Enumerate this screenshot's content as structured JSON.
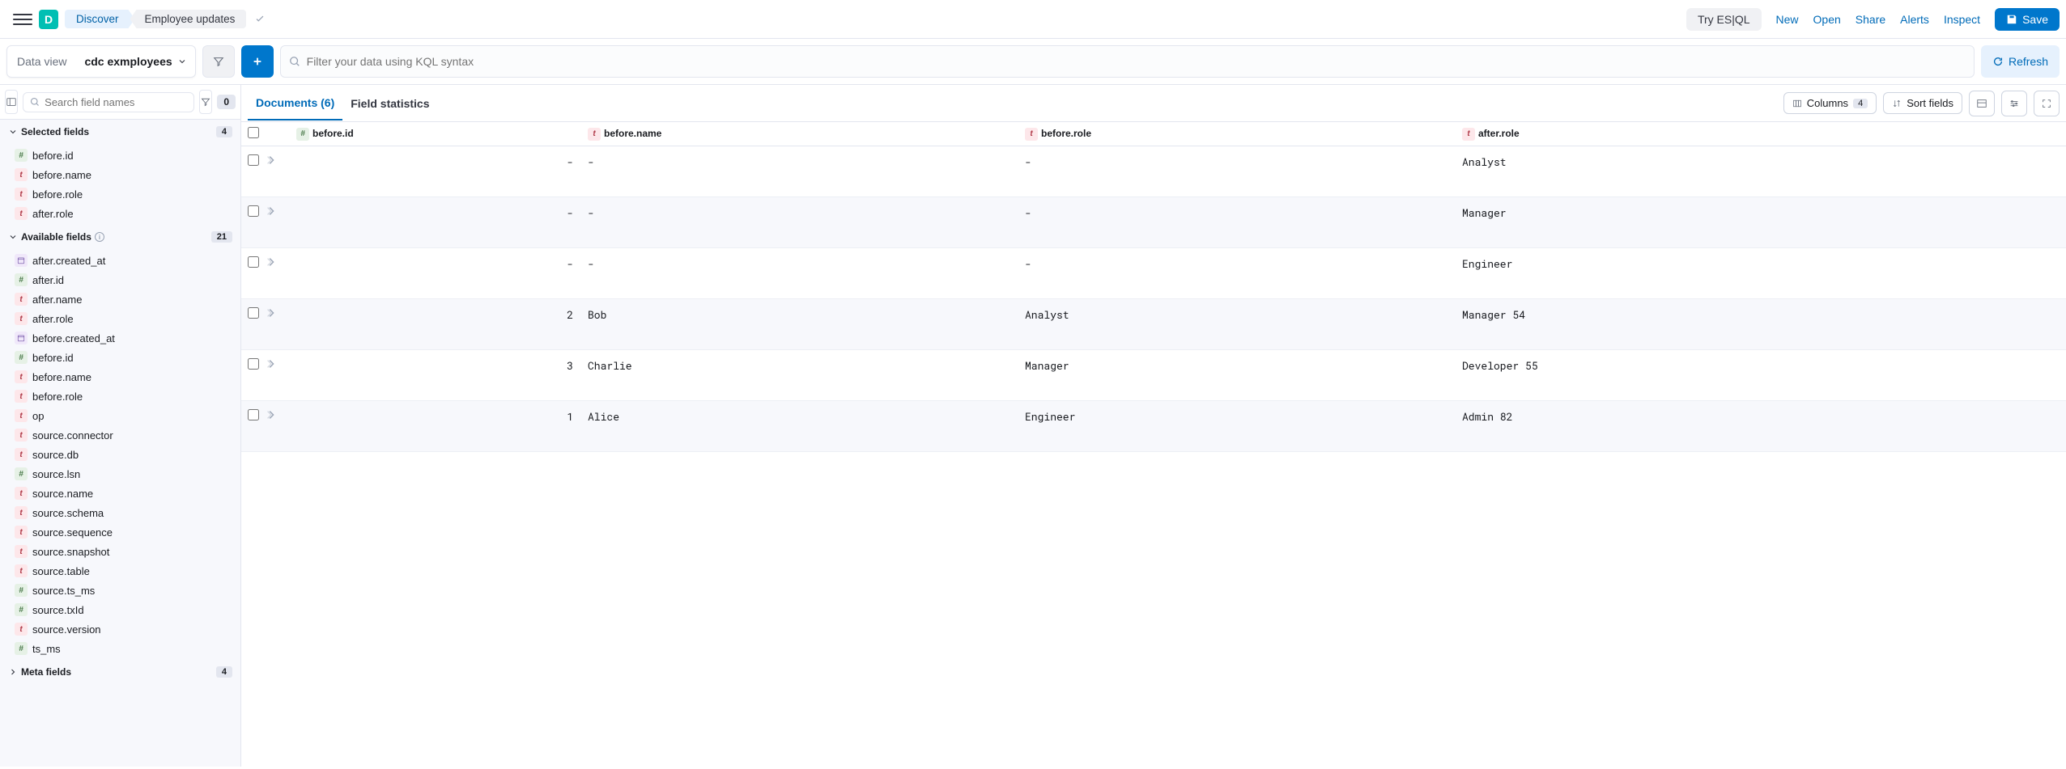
{
  "header": {
    "app_initial": "D",
    "breadcrumb1": "Discover",
    "breadcrumb2": "Employee updates",
    "try_esql": "Try ES|QL",
    "links": [
      "New",
      "Open",
      "Share",
      "Alerts",
      "Inspect"
    ],
    "save": "Save"
  },
  "querybar": {
    "dataview_label": "Data view",
    "dataview_value": "cdc exmployees",
    "search_placeholder": "Filter your data using KQL syntax",
    "refresh": "Refresh"
  },
  "sidebar": {
    "field_search_placeholder": "Search field names",
    "field_count": "0",
    "selected_title": "Selected fields",
    "selected_count": "4",
    "selected_fields": [
      {
        "type": "num",
        "name": "before.id"
      },
      {
        "type": "text",
        "name": "before.name"
      },
      {
        "type": "text",
        "name": "before.role"
      },
      {
        "type": "text",
        "name": "after.role"
      }
    ],
    "available_title": "Available fields",
    "available_count": "21",
    "available_fields": [
      {
        "type": "date",
        "name": "after.created_at"
      },
      {
        "type": "num",
        "name": "after.id"
      },
      {
        "type": "text",
        "name": "after.name"
      },
      {
        "type": "text",
        "name": "after.role"
      },
      {
        "type": "date",
        "name": "before.created_at"
      },
      {
        "type": "num",
        "name": "before.id"
      },
      {
        "type": "text",
        "name": "before.name"
      },
      {
        "type": "text",
        "name": "before.role"
      },
      {
        "type": "text",
        "name": "op"
      },
      {
        "type": "text",
        "name": "source.connector"
      },
      {
        "type": "text",
        "name": "source.db"
      },
      {
        "type": "num",
        "name": "source.lsn"
      },
      {
        "type": "text",
        "name": "source.name"
      },
      {
        "type": "text",
        "name": "source.schema"
      },
      {
        "type": "text",
        "name": "source.sequence"
      },
      {
        "type": "text",
        "name": "source.snapshot"
      },
      {
        "type": "text",
        "name": "source.table"
      },
      {
        "type": "num",
        "name": "source.ts_ms"
      },
      {
        "type": "num",
        "name": "source.txId"
      },
      {
        "type": "text",
        "name": "source.version"
      },
      {
        "type": "num",
        "name": "ts_ms"
      }
    ],
    "meta_title": "Meta fields",
    "meta_count": "4"
  },
  "tabs": {
    "documents": "Documents (6)",
    "fieldstats": "Field statistics",
    "columns": "Columns",
    "columns_count": "4",
    "sort": "Sort fields"
  },
  "table": {
    "cols": [
      {
        "type": "num",
        "label": "before.id"
      },
      {
        "type": "text",
        "label": "before.name"
      },
      {
        "type": "text",
        "label": "before.role"
      },
      {
        "type": "text",
        "label": "after.role"
      }
    ],
    "rows": [
      {
        "id": "-",
        "name": "-",
        "role": "-",
        "after": "Analyst"
      },
      {
        "id": "-",
        "name": "-",
        "role": "-",
        "after": "Manager"
      },
      {
        "id": "-",
        "name": "-",
        "role": "-",
        "after": "Engineer"
      },
      {
        "id": "2",
        "name": "Bob",
        "role": "Analyst",
        "after": "Manager 54"
      },
      {
        "id": "3",
        "name": "Charlie",
        "role": "Manager",
        "after": "Developer 55"
      },
      {
        "id": "1",
        "name": "Alice",
        "role": "Engineer",
        "after": "Admin 82"
      }
    ]
  }
}
